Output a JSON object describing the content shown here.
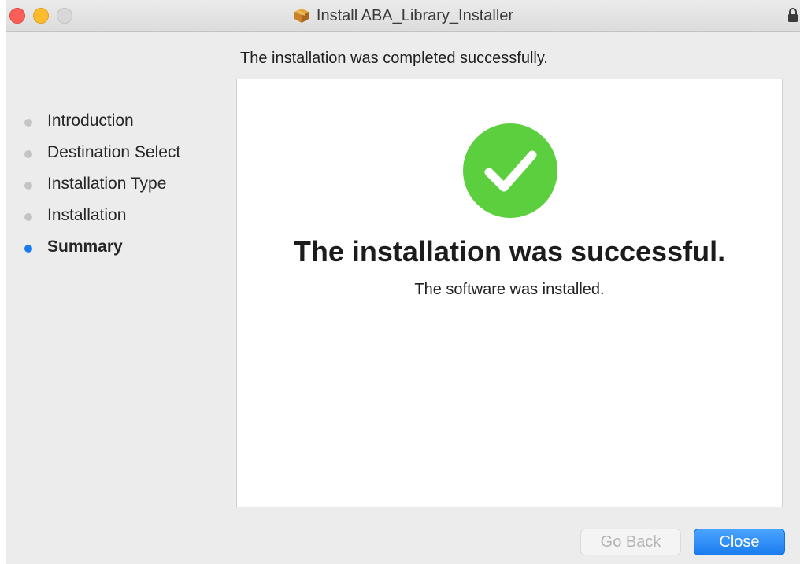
{
  "window": {
    "title": "Install ABA_Library_Installer"
  },
  "step_heading": "The installation was completed successfully.",
  "sidebar": {
    "steps": [
      {
        "label": "Introduction",
        "active": false
      },
      {
        "label": "Destination Select",
        "active": false
      },
      {
        "label": "Installation Type",
        "active": false
      },
      {
        "label": "Installation",
        "active": false
      },
      {
        "label": "Summary",
        "active": true
      }
    ]
  },
  "content": {
    "success_title": "The installation was successful.",
    "success_subtitle": "The software was installed."
  },
  "buttons": {
    "go_back": "Go Back",
    "close": "Close"
  },
  "colors": {
    "accent": "#1a7cf0",
    "success_green": "#5ccf3f",
    "inactive_bullet": "#c4c4c4"
  },
  "icons": [
    "package-icon",
    "lock-icon",
    "success-check-icon"
  ]
}
